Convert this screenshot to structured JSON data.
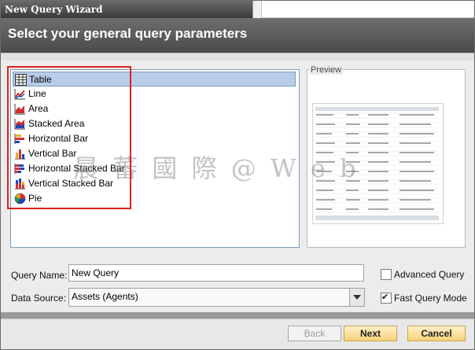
{
  "window": {
    "title": "New Query Wizard"
  },
  "header": {
    "title": "Select your general query parameters"
  },
  "chart_types": [
    {
      "label": "Table",
      "icon": "table-icon",
      "selected": true
    },
    {
      "label": "Line",
      "icon": "line-chart-icon",
      "selected": false
    },
    {
      "label": "Area",
      "icon": "area-chart-icon",
      "selected": false
    },
    {
      "label": "Stacked Area",
      "icon": "stacked-area-chart-icon",
      "selected": false
    },
    {
      "label": "Horizontal Bar",
      "icon": "horizontal-bar-chart-icon",
      "selected": false
    },
    {
      "label": "Vertical Bar",
      "icon": "vertical-bar-chart-icon",
      "selected": false
    },
    {
      "label": "Horizontal Stacked Bar",
      "icon": "horizontal-stacked-bar-chart-icon",
      "selected": false
    },
    {
      "label": "Vertical Stacked Bar",
      "icon": "vertical-stacked-bar-chart-icon",
      "selected": false
    },
    {
      "label": "Pie",
      "icon": "pie-chart-icon",
      "selected": false
    }
  ],
  "preview": {
    "label": "Preview"
  },
  "form": {
    "query_name_label": "Query Name:",
    "query_name_value": "New Query",
    "data_source_label": "Data Source:",
    "data_source_value": "Assets (Agents)",
    "advanced_query_label": "Advanced Query",
    "advanced_query_checked": false,
    "fast_query_label": "Fast Query Mode",
    "fast_query_checked": true
  },
  "buttons": {
    "back": "Back",
    "next": "Next",
    "cancel": "Cancel"
  },
  "watermark": "晨 蕃 國 際 @ W e b"
}
